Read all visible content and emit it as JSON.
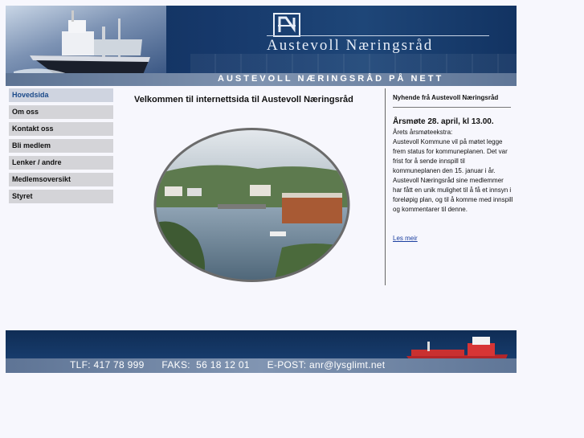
{
  "header": {
    "brand_name": "Austevoll Næringsråd",
    "tagline": "AUSTEVOLL NÆRINGSRÅD PÅ NETT"
  },
  "nav": {
    "items": [
      {
        "label": "Hovedsida",
        "active": true
      },
      {
        "label": "Om oss"
      },
      {
        "label": "Kontakt oss"
      },
      {
        "label": "Bli medlem"
      },
      {
        "label": "Lenker / andre"
      },
      {
        "label": "Medlemsoversikt"
      },
      {
        "label": "Styret"
      }
    ]
  },
  "main": {
    "title": "Velkommen til internettsida til Austevoll Næringsråd"
  },
  "news": {
    "heading": "Nyhende frå Austevoll Næringsråd",
    "item_title": "Årsmøte 28. april, kl 13.00.",
    "item_intro": "Årets årsmøteekstra:",
    "item_body": "Austevoll Kommune vil på møtet legge frem status for kommuneplanen. Det var frist for å sende innspill til kommuneplanen den 15. januar i år. Austevoll Næringsråd sine medlemmer har fått en unik mulighet til å få et innsyn i foreløpig plan, og til å komme med innspill og kommentarer til denne.",
    "read_more": "Les meir"
  },
  "footer": {
    "contact": "TLF: 417 78 999      FAKS:  56 18 12 01      E-POST: anr@lysglimt.net"
  },
  "colors": {
    "banner_dark": "#0d2a52",
    "banner_bar": "#7f93b0",
    "nav_bg": "#d4d4d8",
    "link": "#1b3fa0"
  }
}
